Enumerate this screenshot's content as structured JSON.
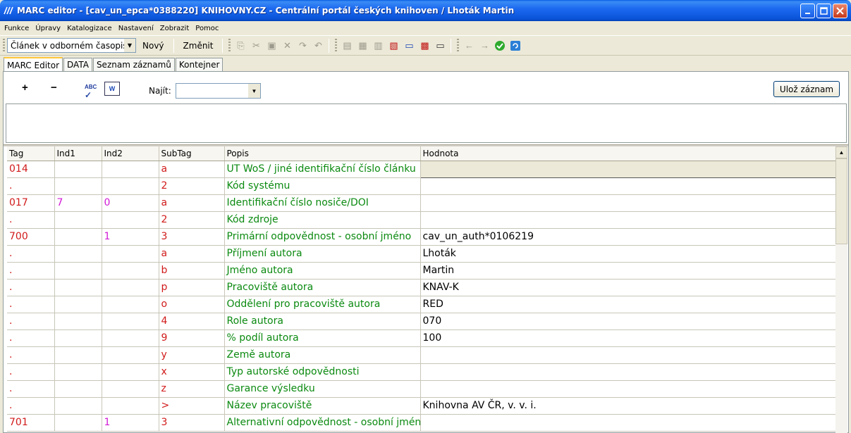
{
  "window": {
    "title": "MARC editor - [cav_un_epca*0388220] KNIHOVNY.CZ - Centrální portál českých knihoven / Lhoták Martin"
  },
  "menu": [
    "Funkce",
    "Úpravy",
    "Katalogizace",
    "Nastavení",
    "Zobrazit",
    "Pomoc"
  ],
  "toolbar": {
    "doc_type": "Článek v odborném časopise",
    "new_label": "Nový",
    "change_label": "Změnit"
  },
  "tabs": [
    "MARC Editor",
    "DATA",
    "Seznam záznamů",
    "Kontejner"
  ],
  "editor": {
    "add": "+",
    "remove": "−",
    "spell_icon_text": "ABC",
    "word_icon_text": "W",
    "find_label": "Najít:",
    "save_label": "Ulož záznam"
  },
  "grid": {
    "columns": [
      "Tag",
      "Ind1",
      "Ind2",
      "SubTag",
      "Popis",
      "Hodnota"
    ],
    "rows": [
      {
        "tag": "014",
        "ind1": "",
        "ind2": "",
        "subtag": "a",
        "popis": "UT WoS / jiné identifikační číslo článku",
        "hodnota": ""
      },
      {
        "tag": ".",
        "ind1": "",
        "ind2": "",
        "subtag": "2",
        "popis": "Kód systému",
        "hodnota": ""
      },
      {
        "tag": "017",
        "ind1": "7",
        "ind2": "0",
        "subtag": "a",
        "popis": "Identifikační číslo nosiče/DOI",
        "hodnota": ""
      },
      {
        "tag": ".",
        "ind1": "",
        "ind2": "",
        "subtag": "2",
        "popis": "Kód zdroje",
        "hodnota": ""
      },
      {
        "tag": "700",
        "ind1": "",
        "ind2": "1",
        "subtag": "3",
        "popis": "Primární odpovědnost - osobní jméno",
        "hodnota": "cav_un_auth*0106219"
      },
      {
        "tag": ".",
        "ind1": "",
        "ind2": "",
        "subtag": "a",
        "popis": "Příjmení autora",
        "hodnota": "Lhoták"
      },
      {
        "tag": ".",
        "ind1": "",
        "ind2": "",
        "subtag": "b",
        "popis": "Jméno autora",
        "hodnota": "Martin"
      },
      {
        "tag": ".",
        "ind1": "",
        "ind2": "",
        "subtag": "p",
        "popis": "Pracoviště autora",
        "hodnota": "KNAV-K"
      },
      {
        "tag": ".",
        "ind1": "",
        "ind2": "",
        "subtag": "o",
        "popis": "Oddělení pro pracoviště autora",
        "hodnota": "RED"
      },
      {
        "tag": ".",
        "ind1": "",
        "ind2": "",
        "subtag": "4",
        "popis": "Role autora",
        "hodnota": "070"
      },
      {
        "tag": ".",
        "ind1": "",
        "ind2": "",
        "subtag": "9",
        "popis": "% podíl autora",
        "hodnota": "100"
      },
      {
        "tag": ".",
        "ind1": "",
        "ind2": "",
        "subtag": "y",
        "popis": "Země autora",
        "hodnota": ""
      },
      {
        "tag": ".",
        "ind1": "",
        "ind2": "",
        "subtag": "x",
        "popis": "Typ autorské odpovědnosti",
        "hodnota": ""
      },
      {
        "tag": ".",
        "ind1": "",
        "ind2": "",
        "subtag": "z",
        "popis": "Garance výsledku",
        "hodnota": ""
      },
      {
        "tag": ".",
        "ind1": "",
        "ind2": "",
        "subtag": ">",
        "popis": "Název pracoviště",
        "hodnota": "Knihovna AV ČR, v. v. i."
      },
      {
        "tag": "701",
        "ind1": "",
        "ind2": "1",
        "subtag": "3",
        "popis": "Alternativní odpovědnost - osobní jméno",
        "hodnota": ""
      }
    ]
  },
  "colors": {
    "tag": "#d11a1a",
    "indicator": "#d21bd6",
    "description": "#0b8a10",
    "titlebar": "#0a54d9"
  }
}
